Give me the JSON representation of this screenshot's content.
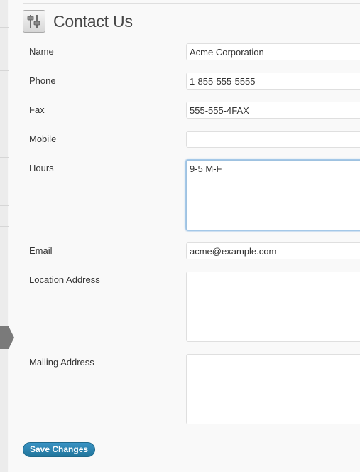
{
  "page": {
    "title": "Contact Us",
    "icon": "settings-sliders-icon"
  },
  "form": {
    "name": {
      "label": "Name",
      "value": "Acme Corporation"
    },
    "phone": {
      "label": "Phone",
      "value": "1-855-555-5555"
    },
    "fax": {
      "label": "Fax",
      "value": "555-555-4FAX"
    },
    "mobile": {
      "label": "Mobile",
      "value": ""
    },
    "hours": {
      "label": "Hours",
      "value": "9-5 M-F"
    },
    "email": {
      "label": "Email",
      "value": "acme@example.com"
    },
    "location_address": {
      "label": "Location Address",
      "value": ""
    },
    "mailing_address": {
      "label": "Mailing Address",
      "value": ""
    }
  },
  "actions": {
    "save_label": "Save Changes"
  },
  "colors": {
    "accent": "#21759b",
    "focus": "#5b9dd9"
  }
}
